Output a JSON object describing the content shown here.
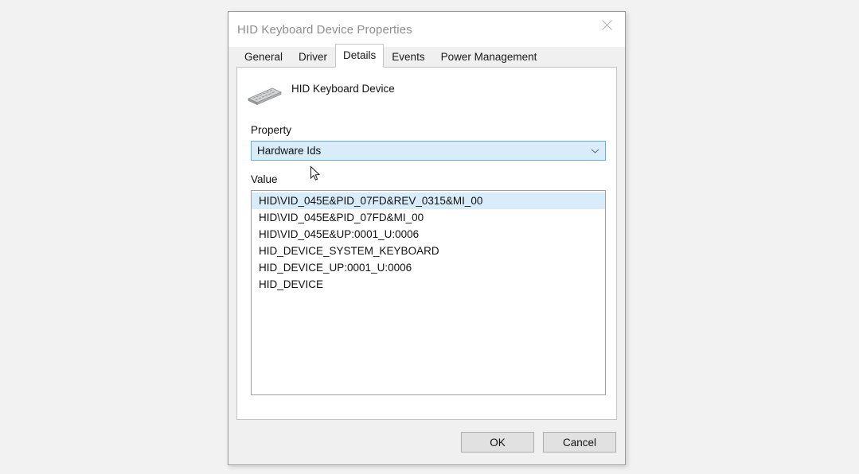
{
  "window": {
    "title": "HID Keyboard Device Properties",
    "close_icon": "close-icon"
  },
  "tabs": [
    {
      "label": "General",
      "selected": false
    },
    {
      "label": "Driver",
      "selected": false
    },
    {
      "label": "Details",
      "selected": true
    },
    {
      "label": "Events",
      "selected": false
    },
    {
      "label": "Power Management",
      "selected": false
    }
  ],
  "device": {
    "name": "HID Keyboard Device",
    "icon": "keyboard-icon"
  },
  "property": {
    "label": "Property",
    "selected_value": "Hardware Ids",
    "dropdown_icon": "chevron-down-icon"
  },
  "value": {
    "label": "Value",
    "items": [
      {
        "text": "HID\\VID_045E&PID_07FD&REV_0315&MI_00",
        "selected": true
      },
      {
        "text": "HID\\VID_045E&PID_07FD&MI_00",
        "selected": false
      },
      {
        "text": "HID\\VID_045E&UP:0001_U:0006",
        "selected": false
      },
      {
        "text": "HID_DEVICE_SYSTEM_KEYBOARD",
        "selected": false
      },
      {
        "text": "HID_DEVICE_UP:0001_U:0006",
        "selected": false
      },
      {
        "text": "HID_DEVICE",
        "selected": false
      }
    ]
  },
  "footer": {
    "ok_label": "OK",
    "cancel_label": "Cancel"
  },
  "colors": {
    "selection": "#d8ecfa",
    "selection_border": "#5fb2e0",
    "dialog_face": "#f0f0f0",
    "desktop": "#f2f2f2",
    "title_text": "#8d8d8d"
  }
}
